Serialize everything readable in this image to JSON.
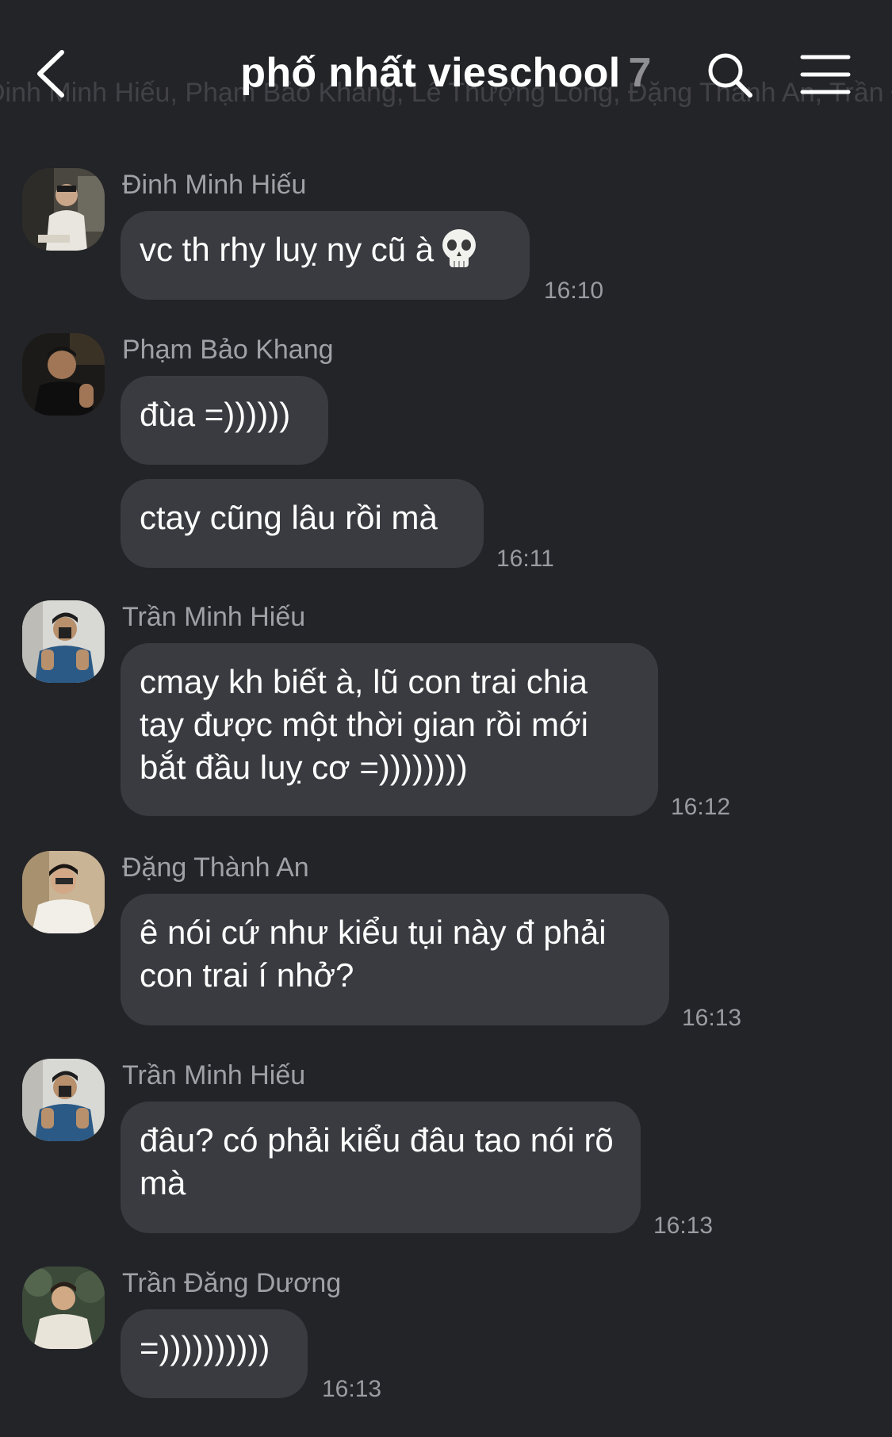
{
  "header": {
    "title": "phố nhất vieschool",
    "member_count": "7",
    "members_subtitle": "Đinh Minh Hiếu, Phạm Bảo Khang, Lê Thượng Long, Đặng Thành An, Trần Đăng",
    "back_icon": "chevron-left-icon",
    "search_icon": "search-icon",
    "menu_icon": "hamburger-menu-icon"
  },
  "messages": [
    {
      "sender": "Đinh Minh Hiếu",
      "bubbles": [
        "vc th rhy luỵ ny cũ à"
      ],
      "emoji": "skull-emoji",
      "time": "16:10"
    },
    {
      "sender": "Phạm Bảo Khang",
      "bubbles": [
        "đùa =))))))",
        "ctay cũng lâu rồi mà"
      ],
      "time": "16:11"
    },
    {
      "sender": "Trần Minh Hiếu",
      "bubbles": [
        "cmay kh biết à, lũ con trai chia tay được một thời gian rồi mới bắt đầu luỵ cơ =))))))))"
      ],
      "time": "16:12"
    },
    {
      "sender": "Đặng Thành An",
      "bubbles": [
        "ê nói cứ như kiểu tụi này đ phải con trai í nhở?"
      ],
      "time": "16:13"
    },
    {
      "sender": "Trần Minh Hiếu",
      "bubbles": [
        "đâu? có phải kiểu đâu tao nói rõ mà"
      ],
      "time": "16:13"
    },
    {
      "sender": "Trần Đăng Dương",
      "bubbles": [
        "=))))))))))"
      ],
      "time": "16:13"
    }
  ],
  "colors": {
    "background": "#232428",
    "bubble": "#3a3b40",
    "sender_text": "#a0a0a7",
    "time_text": "#9b9ba2"
  }
}
